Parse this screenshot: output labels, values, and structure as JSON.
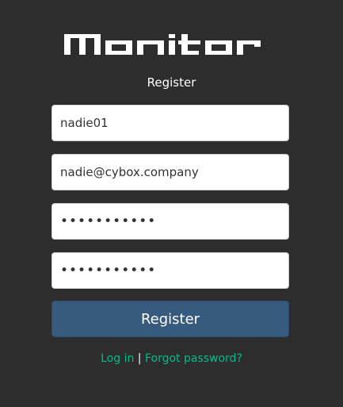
{
  "app": {
    "logo_text": "Monitor",
    "subtitle": "Register"
  },
  "form": {
    "username_value": "nadie01",
    "email_value": "nadie@cybox.company",
    "password_value": "xxxxxxxxxxx",
    "confirm_password_value": "xxxxxxxxxxx",
    "register_label": "Register"
  },
  "links": {
    "login_label": "Log in",
    "separator": "|",
    "forgot_label": "Forgot password?"
  },
  "colors": {
    "background": "#2d2d2d",
    "button": "#375a7f",
    "link": "#00bc8c"
  }
}
